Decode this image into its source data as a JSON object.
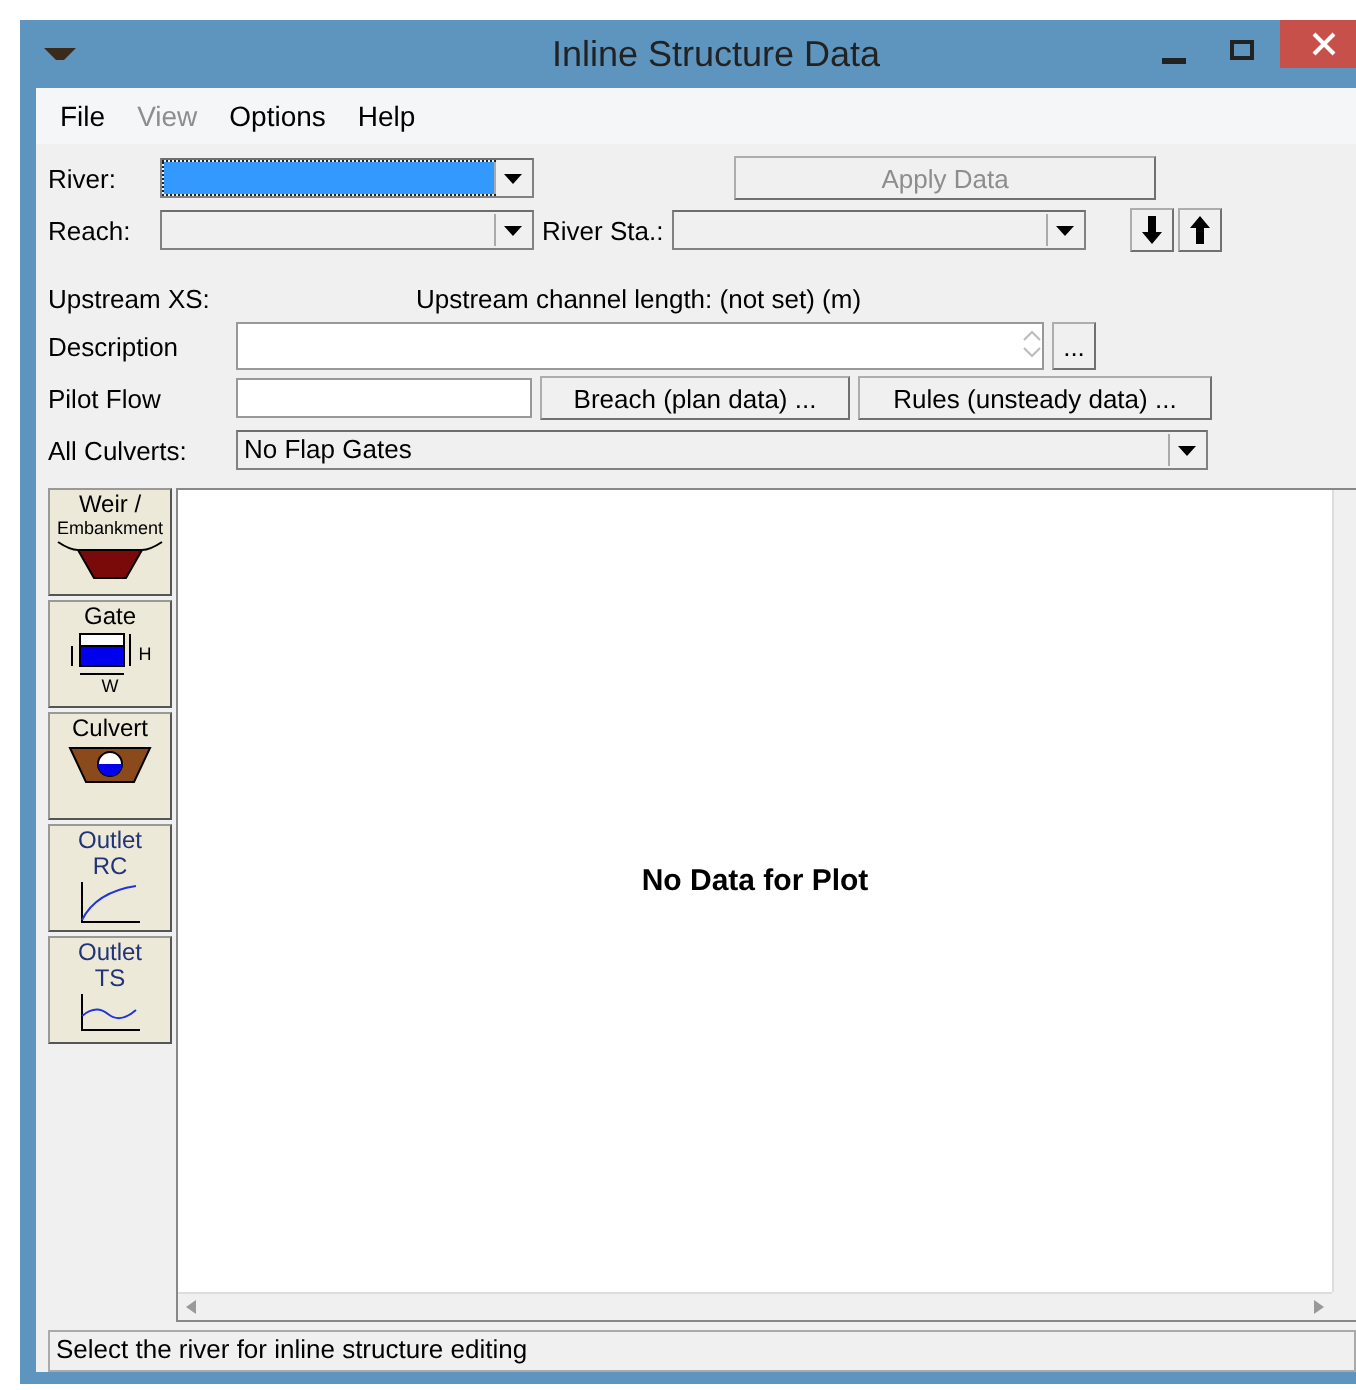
{
  "window": {
    "title": "Inline Structure Data"
  },
  "menu": [
    {
      "label": "File",
      "disabled": false
    },
    {
      "label": "View",
      "disabled": true
    },
    {
      "label": "Options",
      "disabled": false
    },
    {
      "label": "Help",
      "disabled": false
    }
  ],
  "river": {
    "label": "River:",
    "focused": true
  },
  "apply_button": {
    "label": "Apply Data",
    "disabled": true
  },
  "reach": {
    "label": "Reach:"
  },
  "river_sta": {
    "label": "River Sta.:"
  },
  "upstream_xs": {
    "label": "Upstream XS:"
  },
  "channel_length": "Upstream channel length: (not set) (m)",
  "description": {
    "label": "Description",
    "button": "..."
  },
  "pilot_flow": {
    "label": "Pilot Flow"
  },
  "breach_button": "Breach (plan data) ...",
  "rules_button": "Rules (unsteady data) ...",
  "all_culverts": {
    "label": "All Culverts:",
    "value": "No Flap Gates"
  },
  "tools": [
    {
      "kind": "weir",
      "lines": [
        "Weir /",
        "Embankment"
      ]
    },
    {
      "kind": "gate",
      "lines": [
        "Gate"
      ],
      "marks": [
        "H",
        "W"
      ]
    },
    {
      "kind": "culvert",
      "lines": [
        "Culvert"
      ]
    },
    {
      "kind": "rc",
      "lines": [
        "Outlet",
        "RC"
      ]
    },
    {
      "kind": "ts",
      "lines": [
        "Outlet",
        "TS"
      ]
    }
  ],
  "plot": {
    "message": "No Data for Plot"
  },
  "status_bar": "Select the river for inline structure editing"
}
